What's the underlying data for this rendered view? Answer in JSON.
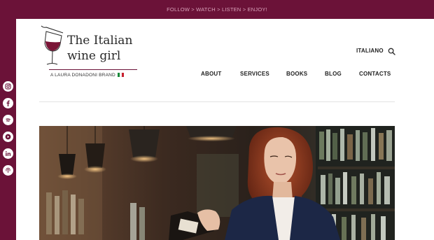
{
  "banner": {
    "text": "FOLLOW > WATCH > LISTEN > ENJOY!"
  },
  "social": [
    {
      "icon": "instagram-icon"
    },
    {
      "icon": "facebook-icon"
    },
    {
      "icon": "spotify-icon"
    },
    {
      "icon": "youtube-icon"
    },
    {
      "icon": "linkedin-icon"
    },
    {
      "icon": "podcast-icon"
    }
  ],
  "logo": {
    "line1": "The Italian",
    "line2": "wine girl",
    "tagline": "A LAURA DONADONI BRAND"
  },
  "header": {
    "language": "ITALIANO",
    "search_icon": "search-icon"
  },
  "nav": {
    "items": [
      {
        "label": "ABOUT"
      },
      {
        "label": "SERVICES"
      },
      {
        "label": "BOOKS"
      },
      {
        "label": "BLOG"
      },
      {
        "label": "CONTACTS"
      }
    ]
  },
  "colors": {
    "brand": "#6b1238",
    "banner_text": "#d9a3bb",
    "nav_text": "#1f1f1f"
  }
}
